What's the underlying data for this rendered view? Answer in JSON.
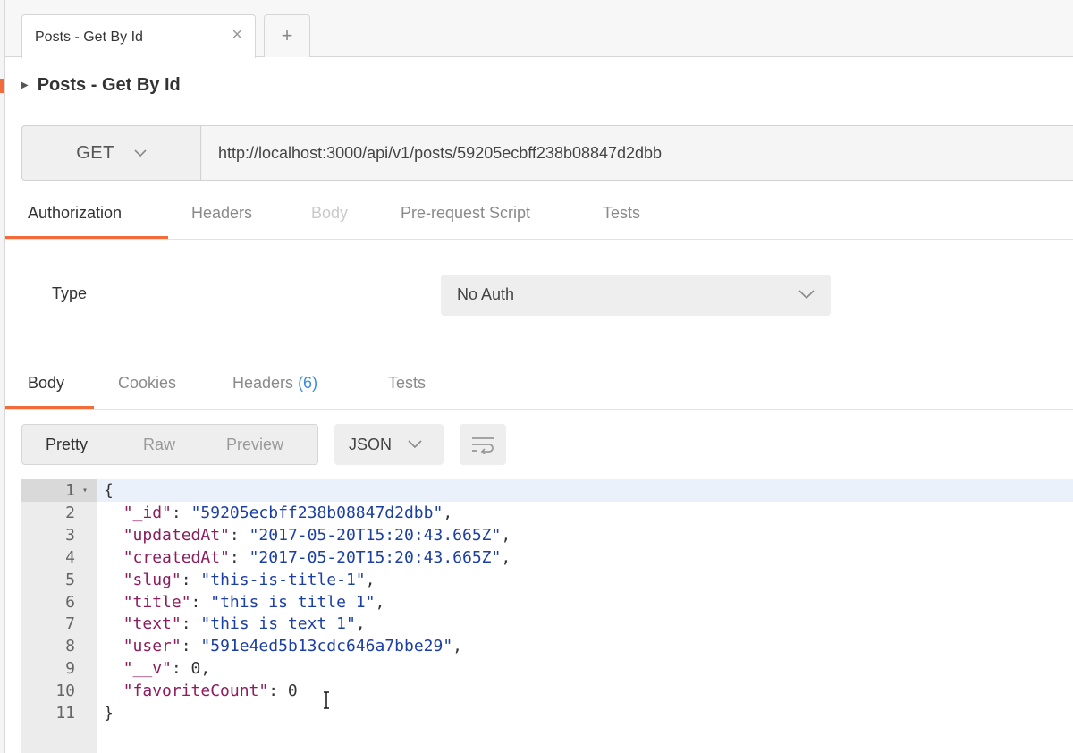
{
  "tab": {
    "label": "Posts - Get By Id",
    "close_glyph": "×",
    "new_tab_glyph": "+"
  },
  "request": {
    "title": "Posts - Get By Id",
    "method": "GET",
    "url": "http://localhost:3000/api/v1/posts/59205ecbff238b08847d2dbb"
  },
  "request_tabs": [
    "Authorization",
    "Headers",
    "Body",
    "Pre-request Script",
    "Tests"
  ],
  "auth": {
    "type_label": "Type",
    "selected": "No Auth"
  },
  "response_tabs": {
    "body": "Body",
    "cookies": "Cookies",
    "headers": "Headers",
    "headers_count": "(6)",
    "tests": "Tests"
  },
  "view_modes": [
    "Pretty",
    "Raw",
    "Preview"
  ],
  "format": "JSON",
  "colors": {
    "accent": "#f26b3a",
    "json_key": "#8b1d5e",
    "json_string": "#1c3fa3",
    "count_blue": "#3b8ed8"
  },
  "icons": [
    "chevron-down-icon",
    "close-icon",
    "plus-icon",
    "wrap-lines-icon",
    "text-cursor-icon",
    "caret-right-icon",
    "fold-caret-icon"
  ],
  "code_lines": [
    {
      "n": "1",
      "parts": [
        {
          "t": "{",
          "c": "n"
        }
      ]
    },
    {
      "n": "2",
      "parts": [
        {
          "t": "  ",
          "c": "n"
        },
        {
          "t": "\"_id\"",
          "c": "k"
        },
        {
          "t": ": ",
          "c": "n"
        },
        {
          "t": "\"59205ecbff238b08847d2dbb\"",
          "c": "s"
        },
        {
          "t": ",",
          "c": "n"
        }
      ]
    },
    {
      "n": "3",
      "parts": [
        {
          "t": "  ",
          "c": "n"
        },
        {
          "t": "\"updatedAt\"",
          "c": "k"
        },
        {
          "t": ": ",
          "c": "n"
        },
        {
          "t": "\"2017-05-20T15:20:43.665Z\"",
          "c": "s"
        },
        {
          "t": ",",
          "c": "n"
        }
      ]
    },
    {
      "n": "4",
      "parts": [
        {
          "t": "  ",
          "c": "n"
        },
        {
          "t": "\"createdAt\"",
          "c": "k"
        },
        {
          "t": ": ",
          "c": "n"
        },
        {
          "t": "\"2017-05-20T15:20:43.665Z\"",
          "c": "s"
        },
        {
          "t": ",",
          "c": "n"
        }
      ]
    },
    {
      "n": "5",
      "parts": [
        {
          "t": "  ",
          "c": "n"
        },
        {
          "t": "\"slug\"",
          "c": "k"
        },
        {
          "t": ": ",
          "c": "n"
        },
        {
          "t": "\"this-is-title-1\"",
          "c": "s"
        },
        {
          "t": ",",
          "c": "n"
        }
      ]
    },
    {
      "n": "6",
      "parts": [
        {
          "t": "  ",
          "c": "n"
        },
        {
          "t": "\"title\"",
          "c": "k"
        },
        {
          "t": ": ",
          "c": "n"
        },
        {
          "t": "\"this is title 1\"",
          "c": "s"
        },
        {
          "t": ",",
          "c": "n"
        }
      ]
    },
    {
      "n": "7",
      "parts": [
        {
          "t": "  ",
          "c": "n"
        },
        {
          "t": "\"text\"",
          "c": "k"
        },
        {
          "t": ": ",
          "c": "n"
        },
        {
          "t": "\"this is text 1\"",
          "c": "s"
        },
        {
          "t": ",",
          "c": "n"
        }
      ]
    },
    {
      "n": "8",
      "parts": [
        {
          "t": "  ",
          "c": "n"
        },
        {
          "t": "\"user\"",
          "c": "k"
        },
        {
          "t": ": ",
          "c": "n"
        },
        {
          "t": "\"591e4ed5b13cdc646a7bbe29\"",
          "c": "s"
        },
        {
          "t": ",",
          "c": "n"
        }
      ]
    },
    {
      "n": "9",
      "parts": [
        {
          "t": "  ",
          "c": "n"
        },
        {
          "t": "\"__v\"",
          "c": "k"
        },
        {
          "t": ": 0,",
          "c": "n"
        }
      ]
    },
    {
      "n": "10",
      "parts": [
        {
          "t": "  ",
          "c": "n"
        },
        {
          "t": "\"favoriteCount\"",
          "c": "k"
        },
        {
          "t": ": 0",
          "c": "n"
        }
      ]
    },
    {
      "n": "11",
      "parts": [
        {
          "t": "}",
          "c": "n"
        }
      ]
    }
  ]
}
